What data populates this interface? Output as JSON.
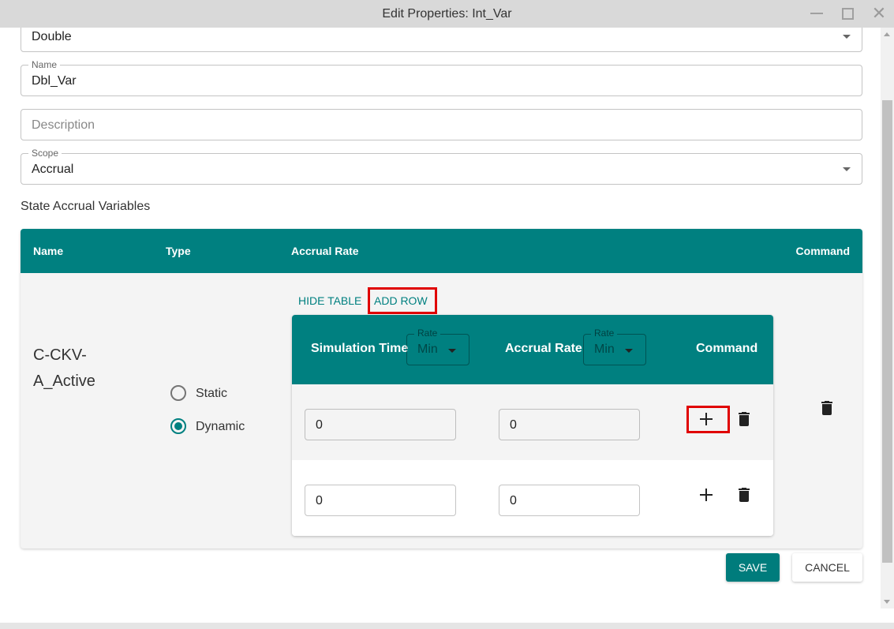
{
  "window": {
    "title": "Edit Properties: Int_Var",
    "close_glyph": "✕"
  },
  "form": {
    "type_value": "Double",
    "name_label": "Name",
    "name_value": "Dbl_Var",
    "description_placeholder": "Description",
    "scope_label": "Scope",
    "scope_value": "Accrual",
    "section_label": "State Accrual Variables"
  },
  "table": {
    "headers": [
      "Name",
      "Type",
      "Accrual Rate",
      "Command"
    ],
    "row": {
      "name_line1": "C-CKV-",
      "name_line2": "A_Active",
      "type_options": [
        {
          "label": "Static",
          "selected": false
        },
        {
          "label": "Dynamic",
          "selected": true
        }
      ],
      "hide_table_label": "HIDE TABLE",
      "add_row_label": "ADD ROW"
    }
  },
  "inner_table": {
    "col_simulation_time": "Simulation Time",
    "col_accrual_rate": "Accrual Rate",
    "col_command": "Command",
    "rate_label": "Rate",
    "sim_rate_value": "Min",
    "accrual_rate_value": "Min",
    "rows": [
      {
        "simulation_time": "0",
        "accrual_rate": "0"
      },
      {
        "simulation_time": "0",
        "accrual_rate": "0"
      }
    ]
  },
  "buttons": {
    "save": "SAVE",
    "cancel": "CANCEL"
  },
  "colors": {
    "accent": "#008080",
    "highlight": "#e00000"
  }
}
